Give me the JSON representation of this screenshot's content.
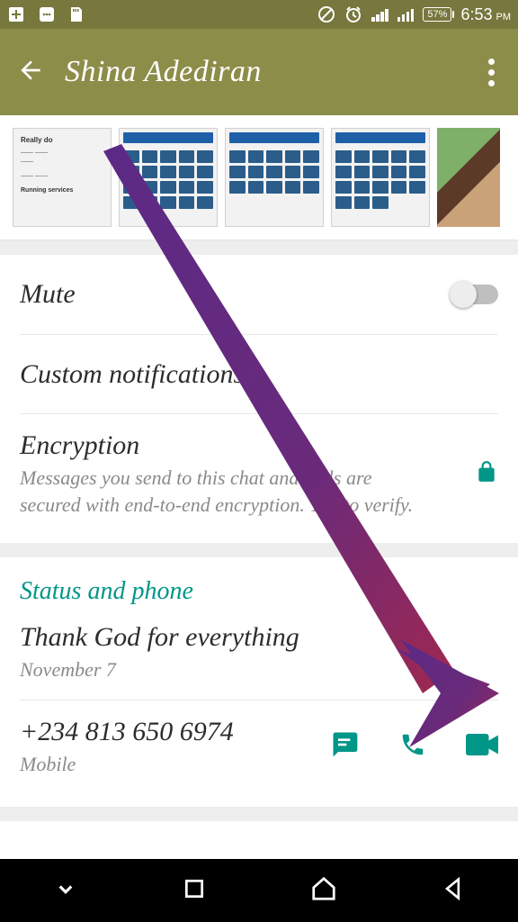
{
  "status_bar": {
    "battery": "57%",
    "time": "6:53",
    "ampm": "PM"
  },
  "app_bar": {
    "title": "Shina Adediran"
  },
  "settings": {
    "mute_label": "Mute",
    "custom_notif_label": "Custom notifications",
    "encryption_title": "Encryption",
    "encryption_desc_line1": "Messages you send to this chat and calls are",
    "encryption_desc_line2": "secured with end-to-end encryption. Tap to verify."
  },
  "status_section": {
    "header": "Status and phone",
    "status_text": "Thank God for everything",
    "status_date": "November 7",
    "phone_number": "+234 813 650 6974",
    "phone_type": "Mobile"
  },
  "colors": {
    "accent_teal": "#009688",
    "olive_dark": "#77773e",
    "olive_light": "#8d8d4a"
  }
}
